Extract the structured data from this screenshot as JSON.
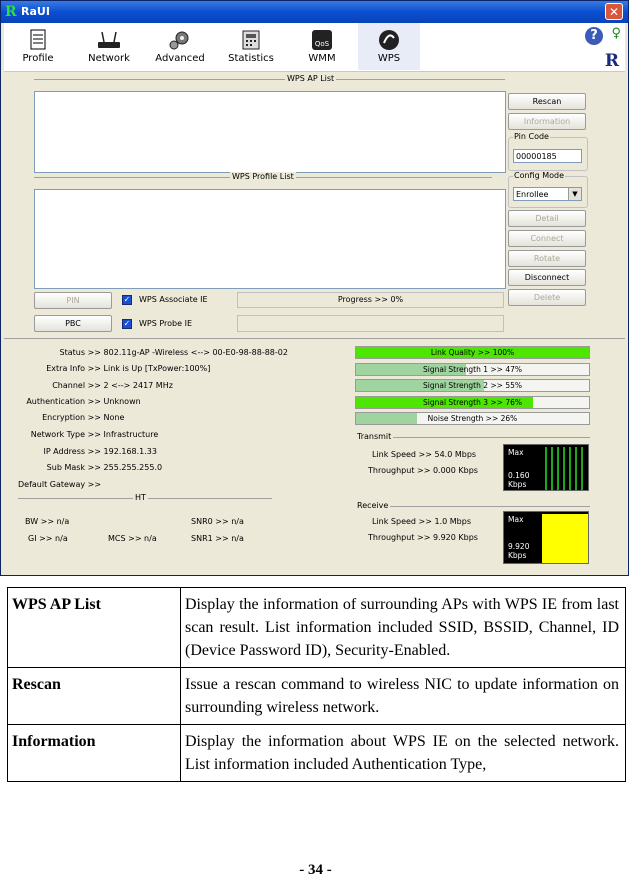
{
  "window": {
    "title": "RaUI",
    "logo": "R"
  },
  "toolbar": {
    "items": [
      {
        "label": "Profile",
        "icon": "profile-icon"
      },
      {
        "label": "Network",
        "icon": "network-icon"
      },
      {
        "label": "Advanced",
        "icon": "advanced-icon"
      },
      {
        "label": "Statistics",
        "icon": "statistics-icon"
      },
      {
        "label": "WMM",
        "icon": "wmm-icon"
      },
      {
        "label": "WPS",
        "icon": "wps-icon",
        "active": true
      }
    ],
    "help": "?"
  },
  "wps": {
    "ap_list_label": "WPS AP List",
    "profile_list_label": "WPS Profile List",
    "buttons": {
      "rescan": "Rescan",
      "information": "Information",
      "detail": "Detail",
      "connect": "Connect",
      "rotate": "Rotate",
      "disconnect": "Disconnect",
      "delete": "Delete",
      "pin": "PIN",
      "pbc": "PBC"
    },
    "pin_code": {
      "label": "Pin Code",
      "value": "00000185"
    },
    "config_mode": {
      "label": "Config Mode",
      "value": "Enrollee"
    },
    "associate_ie": "WPS Associate IE",
    "probe_ie": "WPS Probe IE",
    "progress": "Progress >> 0%"
  },
  "status": {
    "rows": [
      {
        "key": "Status >>",
        "value": "802.11g-AP -Wireless  <--> 00-E0-98-88-88-02"
      },
      {
        "key": "Extra Info >>",
        "value": "Link is Up  [TxPower:100%]"
      },
      {
        "key": "Channel >>",
        "value": "2 <--> 2417 MHz"
      },
      {
        "key": "Authentication >>",
        "value": "Unknown"
      },
      {
        "key": "Encryption >>",
        "value": "None"
      },
      {
        "key": "Network Type >>",
        "value": "Infrastructure"
      },
      {
        "key": "IP Address >>",
        "value": "192.168.1.33"
      },
      {
        "key": "Sub Mask >>",
        "value": "255.255.255.0"
      }
    ],
    "gateway": "Default Gateway >>",
    "ht_label": "HT",
    "ht": {
      "bw": "BW >> n/a",
      "gi": "GI >> n/a",
      "mcs": "MCS >> n/a",
      "snr0": "SNR0 >> n/a",
      "snr1": "SNR1 >> n/a"
    }
  },
  "signal": {
    "bars": [
      {
        "label": "Link Quality >> 100%",
        "value": 100,
        "color": "#4ce600"
      },
      {
        "label": "Signal Strength 1 >> 47%",
        "value": 47,
        "color": "#9fd4a0"
      },
      {
        "label": "Signal Strength 2 >> 55%",
        "value": 55,
        "color": "#9fd4a0"
      },
      {
        "label": "Signal Strength 3 >> 76%",
        "value": 76,
        "color": "#4ce600"
      },
      {
        "label": "Noise Strength >> 26%",
        "value": 26,
        "color": "#9fd4a0"
      }
    ]
  },
  "transmit": {
    "label": "Transmit",
    "link_speed": "Link Speed >>  54.0 Mbps",
    "throughput": "Throughput >> 0.000 Kbps",
    "graph_max": "Max",
    "graph_value": "0.160",
    "graph_unit": "Kbps"
  },
  "receive": {
    "label": "Receive",
    "link_speed": "Link Speed >>  1.0 Mbps",
    "throughput": "Throughput >> 9.920 Kbps",
    "graph_max": "Max",
    "graph_value": "9.920",
    "graph_unit": "Kbps"
  },
  "doc": {
    "rows": [
      {
        "term": "WPS AP List",
        "desc": "Display the information of surrounding APs with WPS IE from last scan result. List information included SSID, BSSID, Channel, ID (Device Password ID), Security-Enabled."
      },
      {
        "term": "Rescan",
        "desc": "Issue a rescan command to wireless NIC to update information on surrounding wireless network."
      },
      {
        "term": "Information",
        "desc": "Display the information about WPS IE on the selected network. List information included Authentication Type,"
      }
    ],
    "page": "- 34 -"
  }
}
